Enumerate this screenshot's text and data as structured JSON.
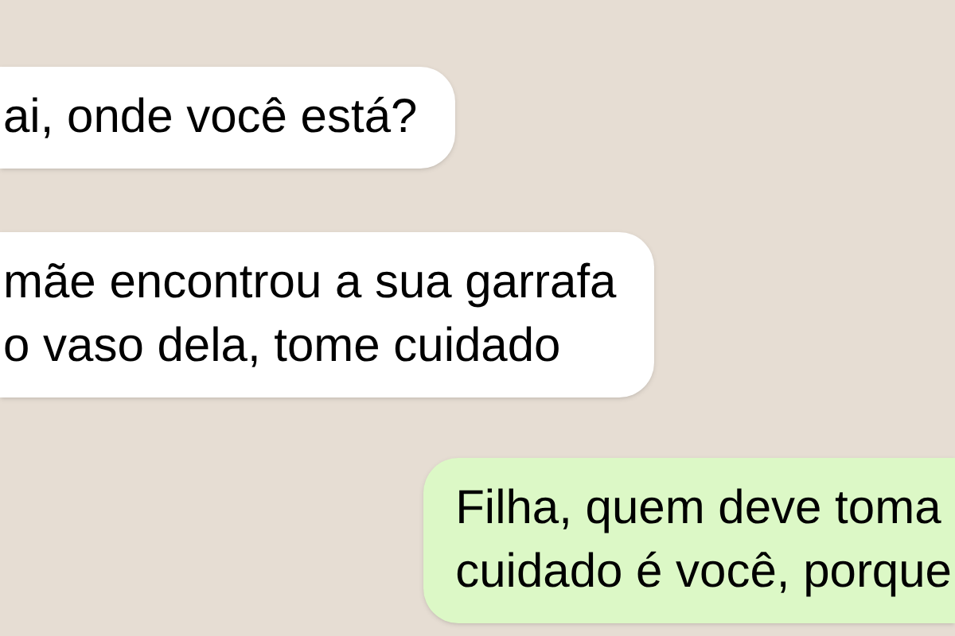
{
  "messages": [
    {
      "kind": "incoming",
      "lines": [
        "ai, onde você está?"
      ]
    },
    {
      "kind": "incoming",
      "lines": [
        "mãe encontrou a sua garrafa",
        "o vaso dela, tome cuidado"
      ]
    },
    {
      "kind": "outgoing",
      "lines": [
        "Filha, quem deve toma",
        "cuidado é você, porque"
      ]
    }
  ]
}
